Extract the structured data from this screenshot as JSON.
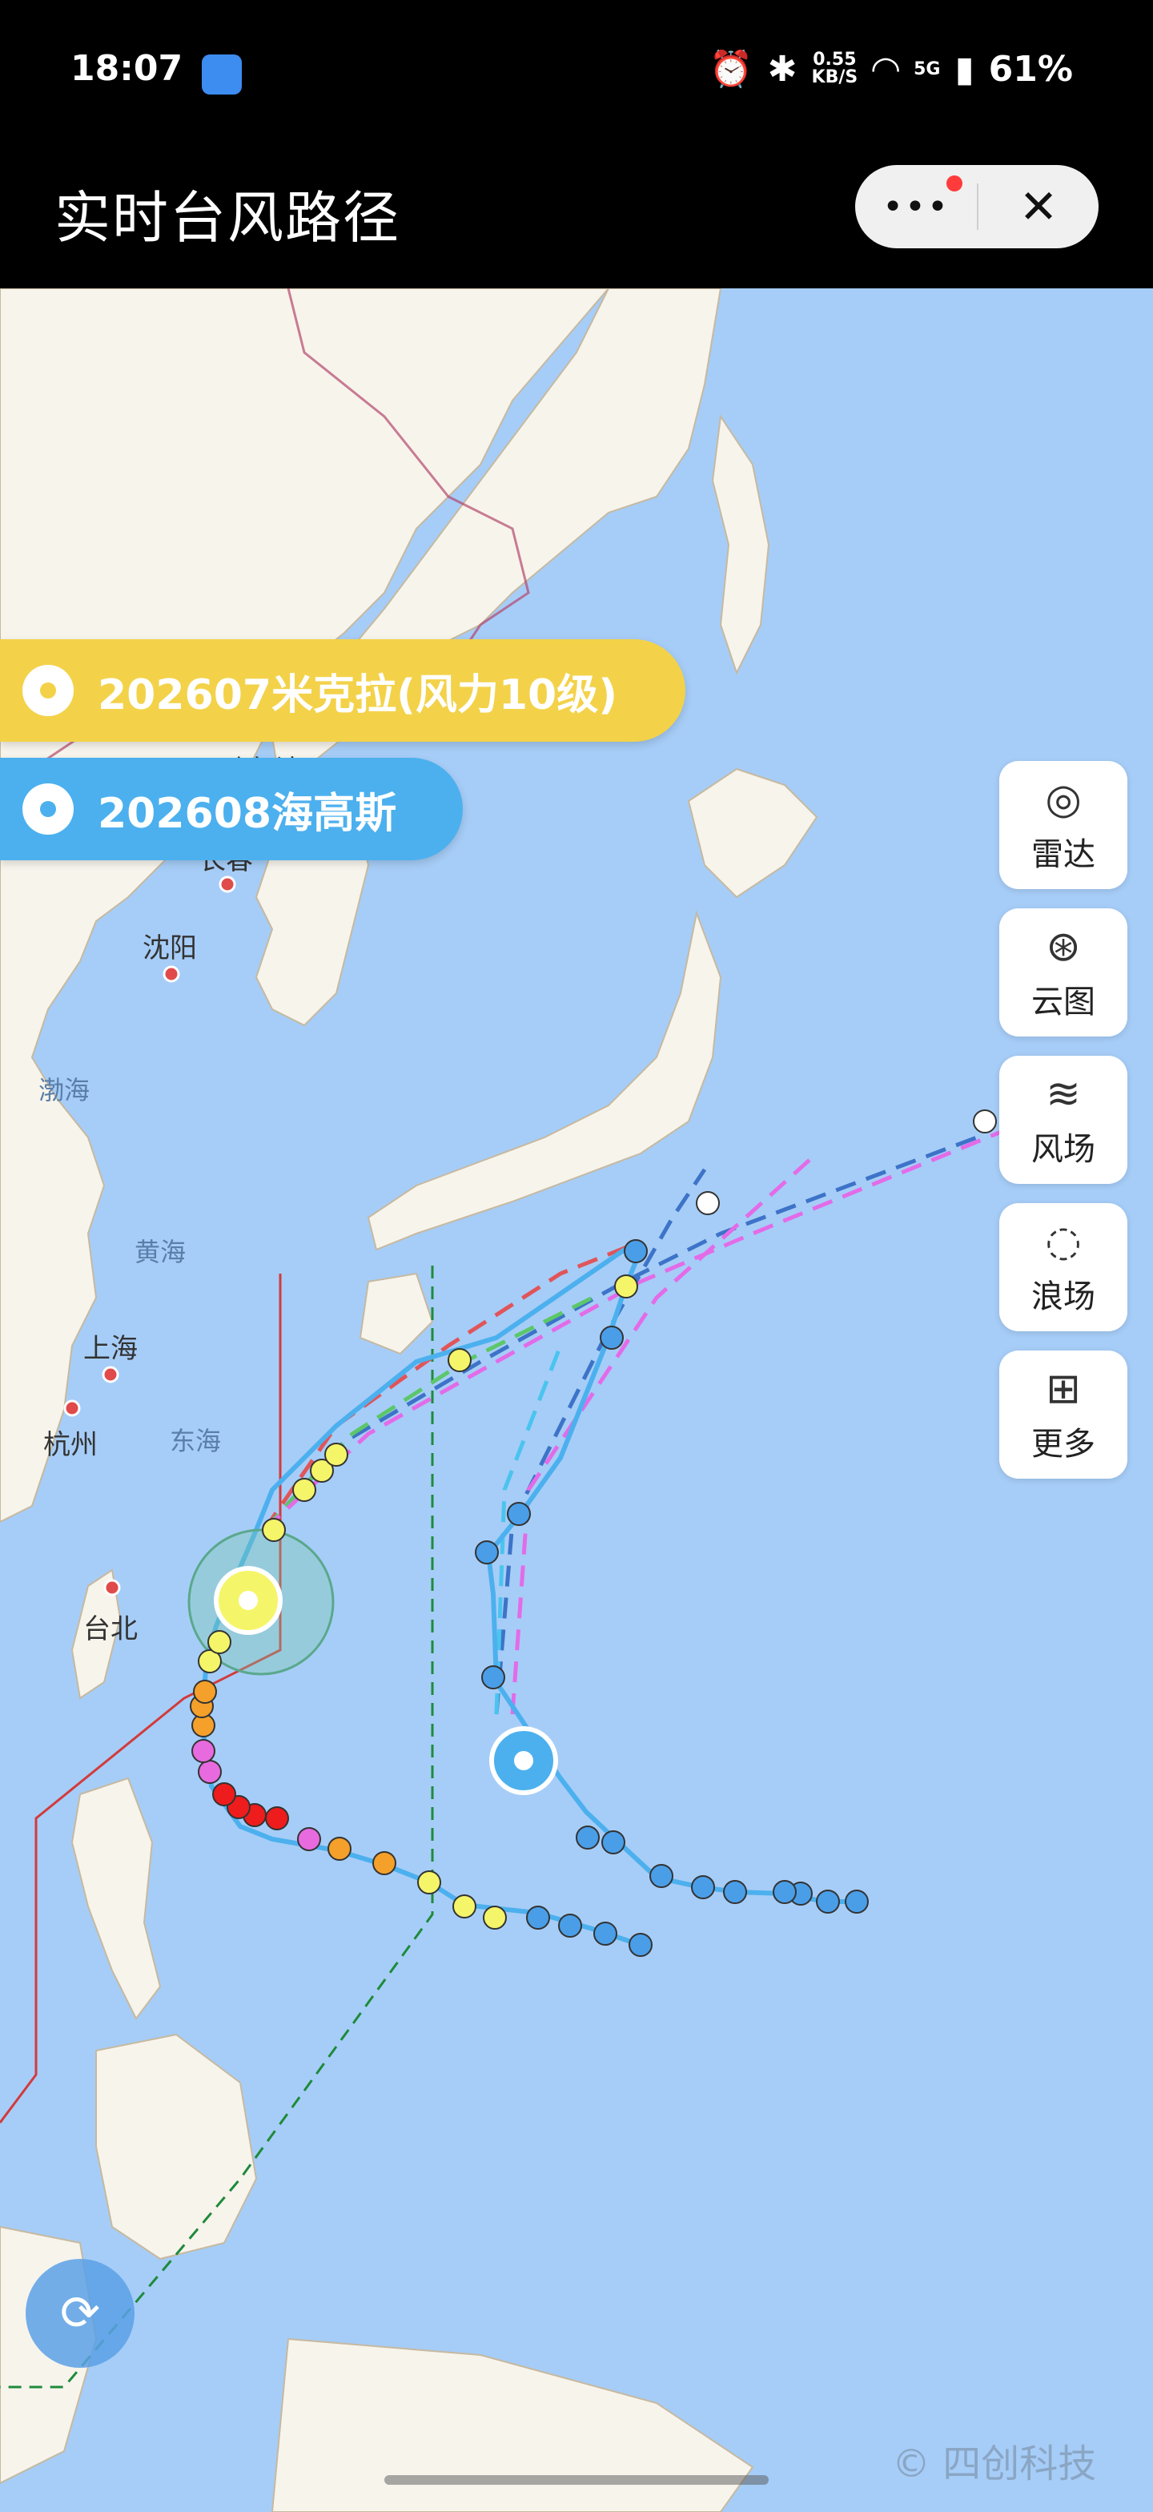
{
  "status_bar": {
    "time": "18:07",
    "speed_value": "0.55",
    "speed_unit": "KB/S",
    "network": "5G",
    "battery": "61%"
  },
  "header": {
    "title": "实时台风路径",
    "more_icon": "more-dots-icon",
    "close_icon": "close-icon"
  },
  "typhoons": [
    {
      "label": "202607米克拉(风力10级)",
      "color": "#f3d24a"
    },
    {
      "label": "202608海高斯",
      "color": "#4cb0ee"
    }
  ],
  "tools": [
    {
      "label": "雷达",
      "icon": "radar-icon"
    },
    {
      "label": "云图",
      "icon": "satellite-icon"
    },
    {
      "label": "风场",
      "icon": "wind-icon"
    },
    {
      "label": "浪场",
      "icon": "wave-icon"
    },
    {
      "label": "更多",
      "icon": "more-grid-icon"
    }
  ],
  "map": {
    "cities": [
      "哈尔滨",
      "长春",
      "沈阳",
      "上海",
      "杭州",
      "台北"
    ],
    "seas": [
      "渤海",
      "黄海",
      "东海"
    ]
  },
  "watermark": "© 四创科技"
}
